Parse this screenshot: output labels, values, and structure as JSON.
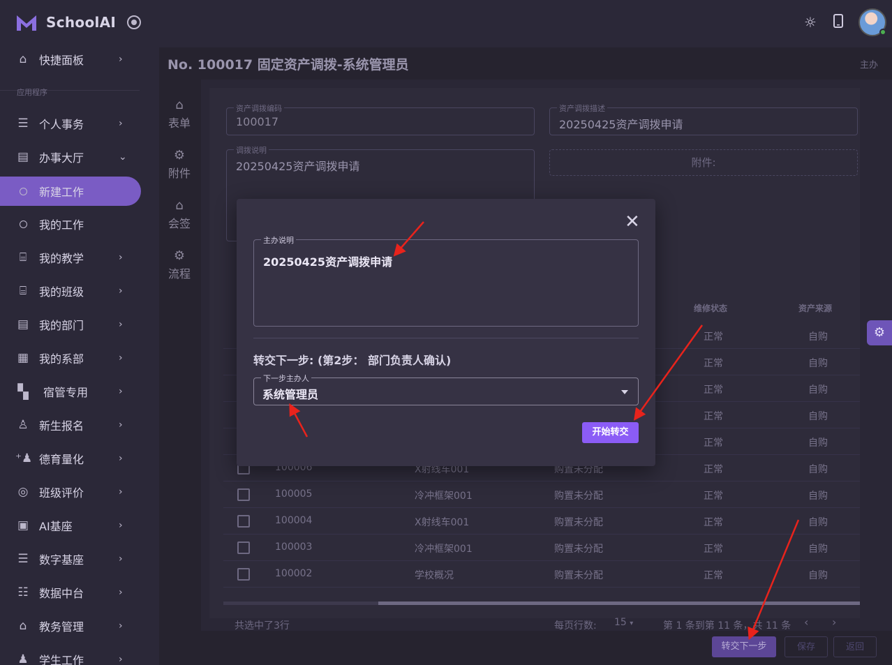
{
  "app": {
    "name": "SchoolAI"
  },
  "sidebar": {
    "section": "应用程序",
    "items": [
      {
        "label": "快捷面板",
        "icon": "home-icon"
      },
      {
        "label": "个人事务",
        "icon": "list-icon"
      },
      {
        "label": "办事大厅",
        "icon": "document-icon"
      },
      {
        "label": "新建工作",
        "icon": "circle-icon"
      },
      {
        "label": "我的工作",
        "icon": "circle-icon"
      },
      {
        "label": "我的教学",
        "icon": "presentation-icon"
      },
      {
        "label": "我的班级",
        "icon": "presentation-icon"
      },
      {
        "label": "我的部门",
        "icon": "document-icon"
      },
      {
        "label": "我的系部",
        "icon": "chart-icon"
      },
      {
        "label": "宿管专用",
        "icon": "building-icon"
      },
      {
        "label": "新生报名",
        "icon": "graduation-icon"
      },
      {
        "label": "德育量化",
        "icon": "user-add-icon"
      },
      {
        "label": "班级评价",
        "icon": "palette-icon"
      },
      {
        "label": "AI基座",
        "icon": "chip-icon"
      },
      {
        "label": "数字基座",
        "icon": "database-icon"
      },
      {
        "label": "数据中台",
        "icon": "database-add-icon"
      },
      {
        "label": "教务管理",
        "icon": "bank-icon"
      },
      {
        "label": "学生工作",
        "icon": "users-icon"
      }
    ]
  },
  "page": {
    "title": "No. 100017 固定资产调拨-系统管理员",
    "right_label": "主办"
  },
  "tabs": [
    {
      "label": "表单",
      "icon": "home-icon"
    },
    {
      "label": "附件",
      "icon": "gear-icon"
    },
    {
      "label": "会签",
      "icon": "home-icon"
    },
    {
      "label": "流程",
      "icon": "gear-icon"
    }
  ],
  "form": {
    "code_label": "资产调拨编码",
    "code_value": "100017",
    "desc_label": "资产调拨描述",
    "desc_value": "20250425资产调拨申请",
    "note_label": "调拨说明",
    "note_value": "20250425资产调拨申请",
    "attach_label": "附件:"
  },
  "table": {
    "headers": {
      "repair": "维修状态",
      "source": "资产来源"
    },
    "top_rows": [
      {
        "repair": "正常",
        "source": "自购"
      },
      {
        "repair": "正常",
        "source": "自购"
      },
      {
        "repair": "正常",
        "source": "自购"
      },
      {
        "repair": "正常",
        "source": "自购"
      },
      {
        "repair": "正常",
        "source": "自购"
      }
    ],
    "rows": [
      {
        "code": "100006",
        "name": "X射线车001",
        "status": "购置未分配",
        "repair": "正常",
        "source": "自购"
      },
      {
        "code": "100005",
        "name": "冷冲框架001",
        "status": "购置未分配",
        "repair": "正常",
        "source": "自购"
      },
      {
        "code": "100004",
        "name": "X射线车001",
        "status": "购置未分配",
        "repair": "正常",
        "source": "自购"
      },
      {
        "code": "100003",
        "name": "冷冲框架001",
        "status": "购置未分配",
        "repair": "正常",
        "source": "自购"
      },
      {
        "code": "100002",
        "name": "学校概况",
        "status": "购置未分配",
        "repair": "正常",
        "source": "自购"
      }
    ],
    "footer": {
      "selected": "共选中了3行",
      "rows_per_page_label": "每页行数:",
      "rows_per_page": "15",
      "range": "第 1 条到第 11 条，共 11 条"
    }
  },
  "bottom_buttons": {
    "next": "转交下一步",
    "save": "保存",
    "back": "返回"
  },
  "dialog": {
    "note_label": "主办说明",
    "note_value": "20250425资产调拨申请",
    "step_text": "转交下一步: (第2步： 部门负责人确认)",
    "handler_label": "下一步主办人",
    "handler_value": "系统管理员",
    "submit": "开始转交"
  },
  "colors": {
    "accent": "#8b5cf6",
    "active_nav": "#7a5cc4",
    "annotation": "#e8231c"
  }
}
